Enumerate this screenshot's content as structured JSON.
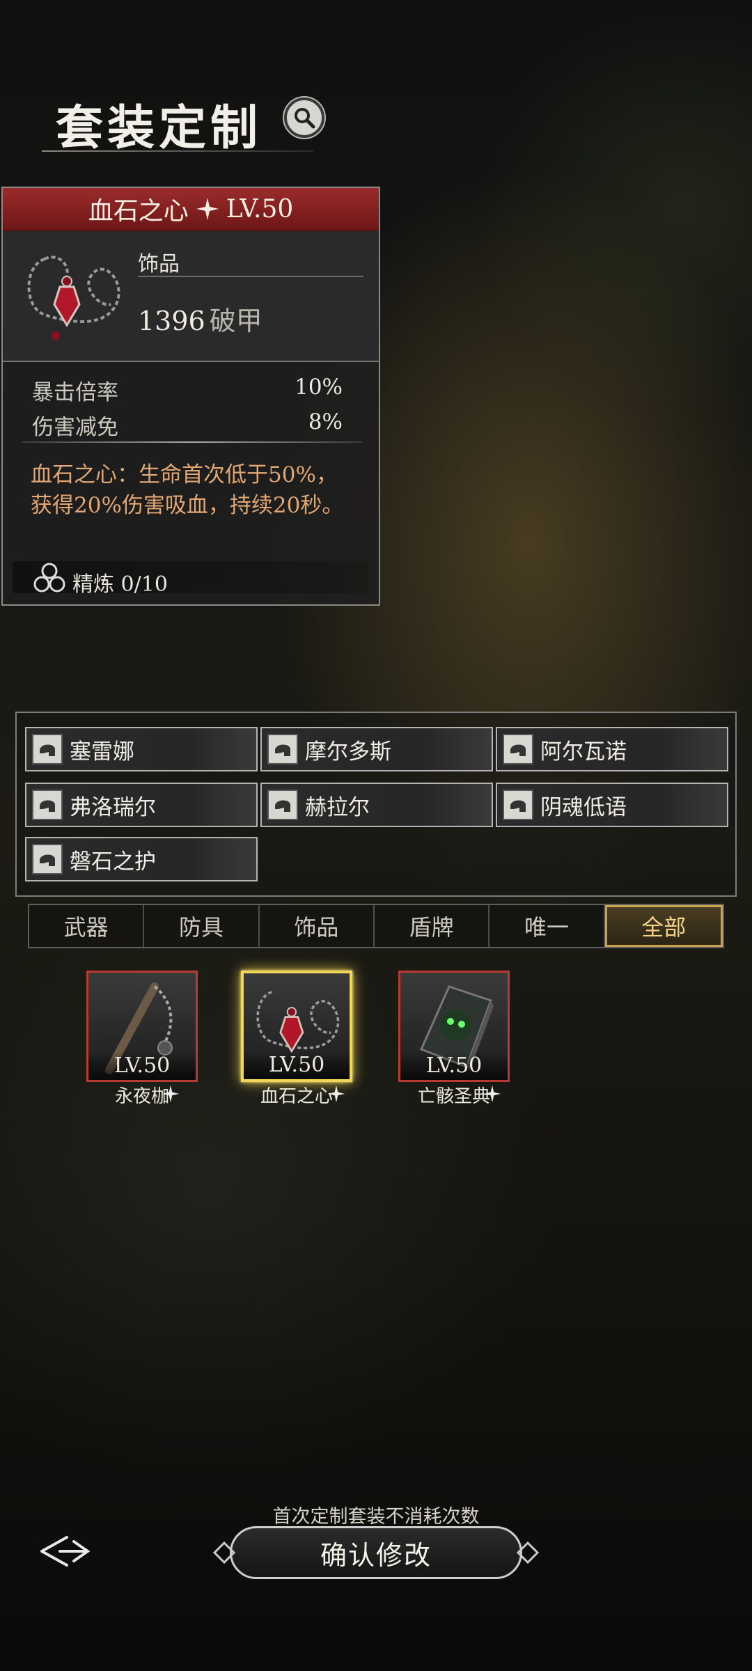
{
  "header": {
    "title": "套装定制"
  },
  "card": {
    "name": "血石之心",
    "level": "LV.50",
    "type": "饰品",
    "main_value": "1396",
    "main_unit": "破甲",
    "stats": [
      {
        "label": "暴击倍率",
        "value": "10%"
      },
      {
        "label": "伤害减免",
        "value": "8%"
      }
    ],
    "description": "血石之心：生命首次低于50%，获得20%伤害吸血，持续20秒。",
    "refine": "精炼 0/10"
  },
  "sets": [
    "塞雷娜",
    "摩尔多斯",
    "阿尔瓦诺",
    "弗洛瑞尔",
    "赫拉尔",
    "阴魂低语",
    "磐石之护"
  ],
  "tabs": [
    {
      "label": "武器",
      "active": false
    },
    {
      "label": "防具",
      "active": false
    },
    {
      "label": "饰品",
      "active": false
    },
    {
      "label": "盾牌",
      "active": false
    },
    {
      "label": "唯一",
      "active": false
    },
    {
      "label": "全部",
      "active": true
    }
  ],
  "items": [
    {
      "name": "永夜枷",
      "level": "LV.50",
      "selected": false
    },
    {
      "name": "血石之心",
      "level": "LV.50",
      "selected": true
    },
    {
      "name": "亡骸圣典",
      "level": "LV.50",
      "selected": false
    }
  ],
  "footer": {
    "note": "首次定制套装不消耗次数",
    "confirm_label": "确认修改"
  },
  "colors": {
    "accent_gold": "#f2d65a",
    "header_red": "#8a2424",
    "desc_orange": "#e3a773"
  }
}
